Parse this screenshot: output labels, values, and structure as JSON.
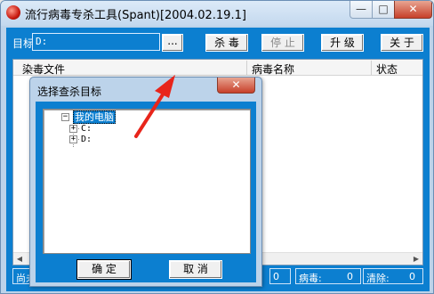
{
  "window": {
    "title": "流行病毒专杀工具(Spant)[2004.02.19.1]",
    "min_glyph": "—",
    "max_glyph": "□",
    "close_glyph": "✕"
  },
  "toolbar": {
    "target_label": "目标",
    "target_value": "D:",
    "browse_label": "...",
    "kill_label": "杀 毒",
    "stop_label": "停 止",
    "upgrade_label": "升 级",
    "about_label": "关 于"
  },
  "list": {
    "columns": [
      "染毒文件",
      "病毒名称",
      "状态"
    ]
  },
  "statusbar": {
    "scan_label": "尚未",
    "virus_label": "病毒:",
    "virus_count": "0",
    "cleaned_label": "清除:",
    "cleaned_count": "0",
    "extra_count": "0"
  },
  "dialog": {
    "title": "选择查杀目标",
    "close_glyph": "✕",
    "tree": {
      "root": "我的电脑",
      "children": [
        "C:",
        "D:"
      ]
    },
    "ok_label": "确 定",
    "cancel_label": "取 消"
  },
  "colors": {
    "client_blue": "#0c7fd0",
    "frame": "#bcd3ea",
    "close_red": "#c7402a",
    "annotation_red": "#e8251b"
  },
  "icons": {
    "app": "red-sphere-icon",
    "expand": "plus-box-icon",
    "collapse": "minus-box-icon"
  }
}
